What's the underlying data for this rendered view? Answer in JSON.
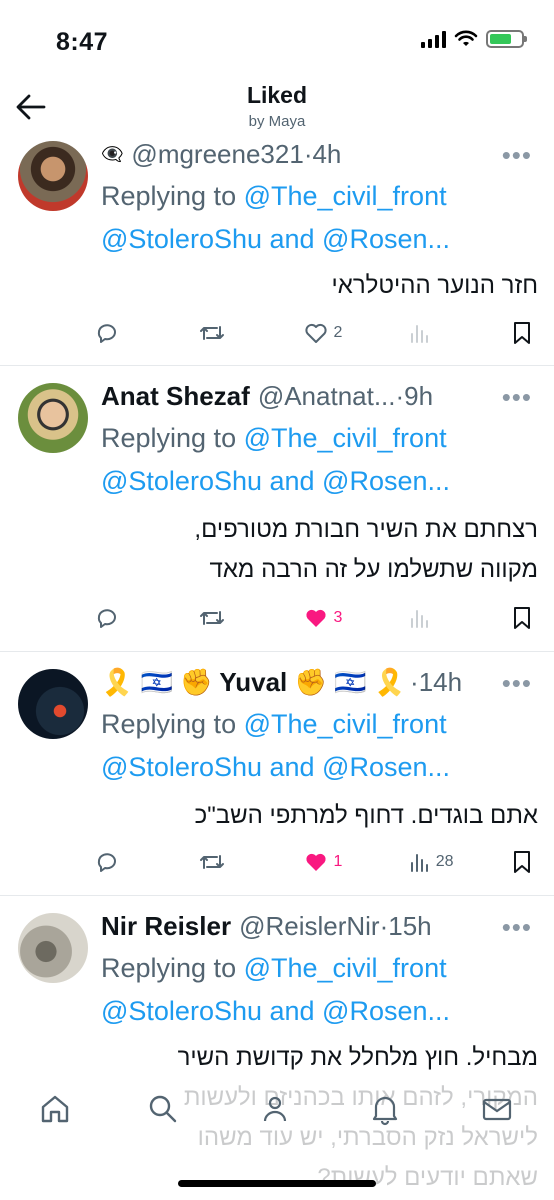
{
  "status": {
    "time": "8:47"
  },
  "header": {
    "title": "Liked",
    "subtitle": "by Maya"
  },
  "tweets": [
    {
      "prefix_emoji": "👁‍🗨",
      "name": "",
      "handle": "@mgreene321",
      "time": "·4h",
      "reply_prefix": "Replying to ",
      "reply_to_1": "@The_civil_front",
      "reply_to_2": "@StoleroShu and @Rosen...",
      "body": "חזר הנוער ההיטלראי",
      "likes": "2",
      "views": "",
      "liked": false
    },
    {
      "name": "Anat Shezaf",
      "handle": "@Anatnat...",
      "time": "·9h",
      "reply_prefix": "Replying to ",
      "reply_to_1": "@The_civil_front",
      "reply_to_2": "@StoleroShu and @Rosen...",
      "body": "רצחתם את  השיר חבורת מטורפים,\nמקווה  שתשלמו על זה  הרבה  מאד",
      "likes": "3",
      "views": "",
      "liked": true
    },
    {
      "name": "🎗️ 🇮🇱 ✊ Yuval ✊ 🇮🇱 🎗️",
      "handle": "",
      "time": "·14h",
      "reply_prefix": "Replying to ",
      "reply_to_1": "@The_civil_front",
      "reply_to_2": "@StoleroShu and @Rosen...",
      "body": "אתם בוגדים. דחוף למרתפי השב\"כ",
      "likes": "1",
      "views": "28",
      "liked": true
    },
    {
      "name": "Nir Reisler",
      "handle": "@ReislerNir",
      "time": "·15h",
      "reply_prefix": "Replying to ",
      "reply_to_1": "@The_civil_front",
      "reply_to_2": "@StoleroShu and @Rosen...",
      "body": "מבחיל. חוץ מלחלל את קדושת השיר\nהמקורי, לזהם אותו בכהניזם ולעשות\nלישראל נזק הסברתי, יש עוד משהו\nשאתם יודעים לעשות?"
    }
  ],
  "colors": {
    "link": "#1d9bf0",
    "like": "#f91880",
    "muted": "#536471"
  }
}
